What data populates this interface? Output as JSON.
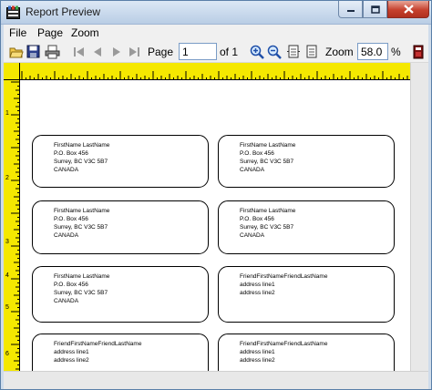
{
  "window": {
    "title": "Report Preview"
  },
  "menu": {
    "items": [
      "File",
      "Page",
      "Zoom"
    ]
  },
  "toolbar": {
    "page_label": "Page",
    "page_value": "1",
    "of_label": "of 1",
    "zoom_label": "Zoom",
    "zoom_value": "58.0",
    "percent_label": "%",
    "icons": [
      "open-folder-icon",
      "save-icon",
      "print-icon",
      "first-page-icon",
      "previous-page-icon",
      "next-page-icon",
      "last-page-icon",
      "zoom-in-icon",
      "zoom-out-icon",
      "fit-width-icon",
      "fit-page-icon",
      "exit-icon"
    ]
  },
  "ruler": {
    "left_numbers": [
      "1",
      "2",
      "3",
      "4",
      "5",
      "6"
    ]
  },
  "labels": [
    {
      "lines": [
        "FirstName LastName",
        "P.O. Box 456",
        "Surrey,  BC   V3C 5B7",
        "CANADA"
      ]
    },
    {
      "lines": [
        "FirstName LastName",
        "P.O. Box 456",
        "Surrey,  BC   V3C 5B7",
        "CANADA"
      ]
    },
    {
      "lines": [
        "FirstName LastName",
        "P.O. Box 456",
        "Surrey,  BC   V3C 5B7",
        "CANADA"
      ]
    },
    {
      "lines": [
        "FirstName LastName",
        "P.O. Box 456",
        "Surrey,  BC   V3C 5B7",
        "CANADA"
      ]
    },
    {
      "lines": [
        "FirstName LastName",
        "P.O. Box 456",
        "Surrey,  BC   V3C 5B7",
        "CANADA"
      ]
    },
    {
      "lines": [
        "FriendFirstNameFriendLastName",
        "address line1",
        "address line2"
      ]
    },
    {
      "lines": [
        "FriendFirstNameFriendLastName",
        "address line1",
        "address line2"
      ]
    },
    {
      "lines": [
        "FriendFirstNameFriendLastName",
        "address line1",
        "address line2"
      ]
    }
  ],
  "colors": {
    "ruler": "#f5e800",
    "title_bar": "#c8d8ec",
    "close_button": "#c6402d"
  }
}
